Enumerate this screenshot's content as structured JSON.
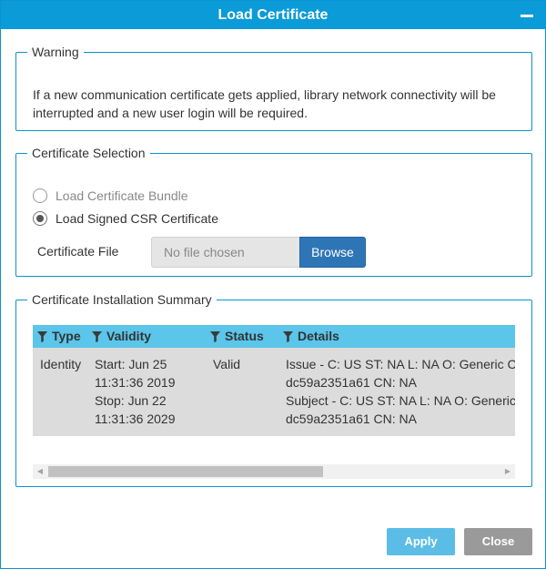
{
  "dialog": {
    "title": "Load Certificate"
  },
  "warning": {
    "legend": "Warning",
    "line1": "If a new communication certificate gets applied, library network connectivity will be",
    "line2": "interrupted and a new user login will be required."
  },
  "selection": {
    "legend": "Certificate Selection",
    "options": [
      {
        "label": "Load Certificate Bundle",
        "selected": false,
        "disabled": true
      },
      {
        "label": "Load Signed CSR Certificate",
        "selected": true,
        "disabled": false
      }
    ],
    "file_label": "Certificate File",
    "file_placeholder": "No file chosen",
    "browse_label": "Browse"
  },
  "summary": {
    "legend": "Certificate Installation Summary",
    "columns": [
      "Type",
      "Validity",
      "Status",
      "Details"
    ],
    "rows": [
      {
        "type": "Identity",
        "validity": [
          "Start: Jun 25",
          "11:31:36 2019",
          "Stop: Jun 22",
          "11:31:36 2029"
        ],
        "status": "Valid",
        "details": [
          "Issue - C: US ST: NA L: NA O: Generic Company",
          "dc59a2351a61 CN: NA",
          "Subject - C: US ST: NA L: NA O: Generic Company",
          "dc59a2351a61 CN: NA"
        ]
      }
    ]
  },
  "buttons": {
    "apply": "Apply",
    "close": "Close"
  },
  "colors": {
    "titlebar": "#0a9bd8",
    "table_header": "#5bc5ea",
    "browse": "#2e75b6",
    "apply": "#5bbde6",
    "close": "#9a9a9a"
  },
  "icons": {
    "minimize": "minimize-icon",
    "filter": "filter-icon"
  }
}
